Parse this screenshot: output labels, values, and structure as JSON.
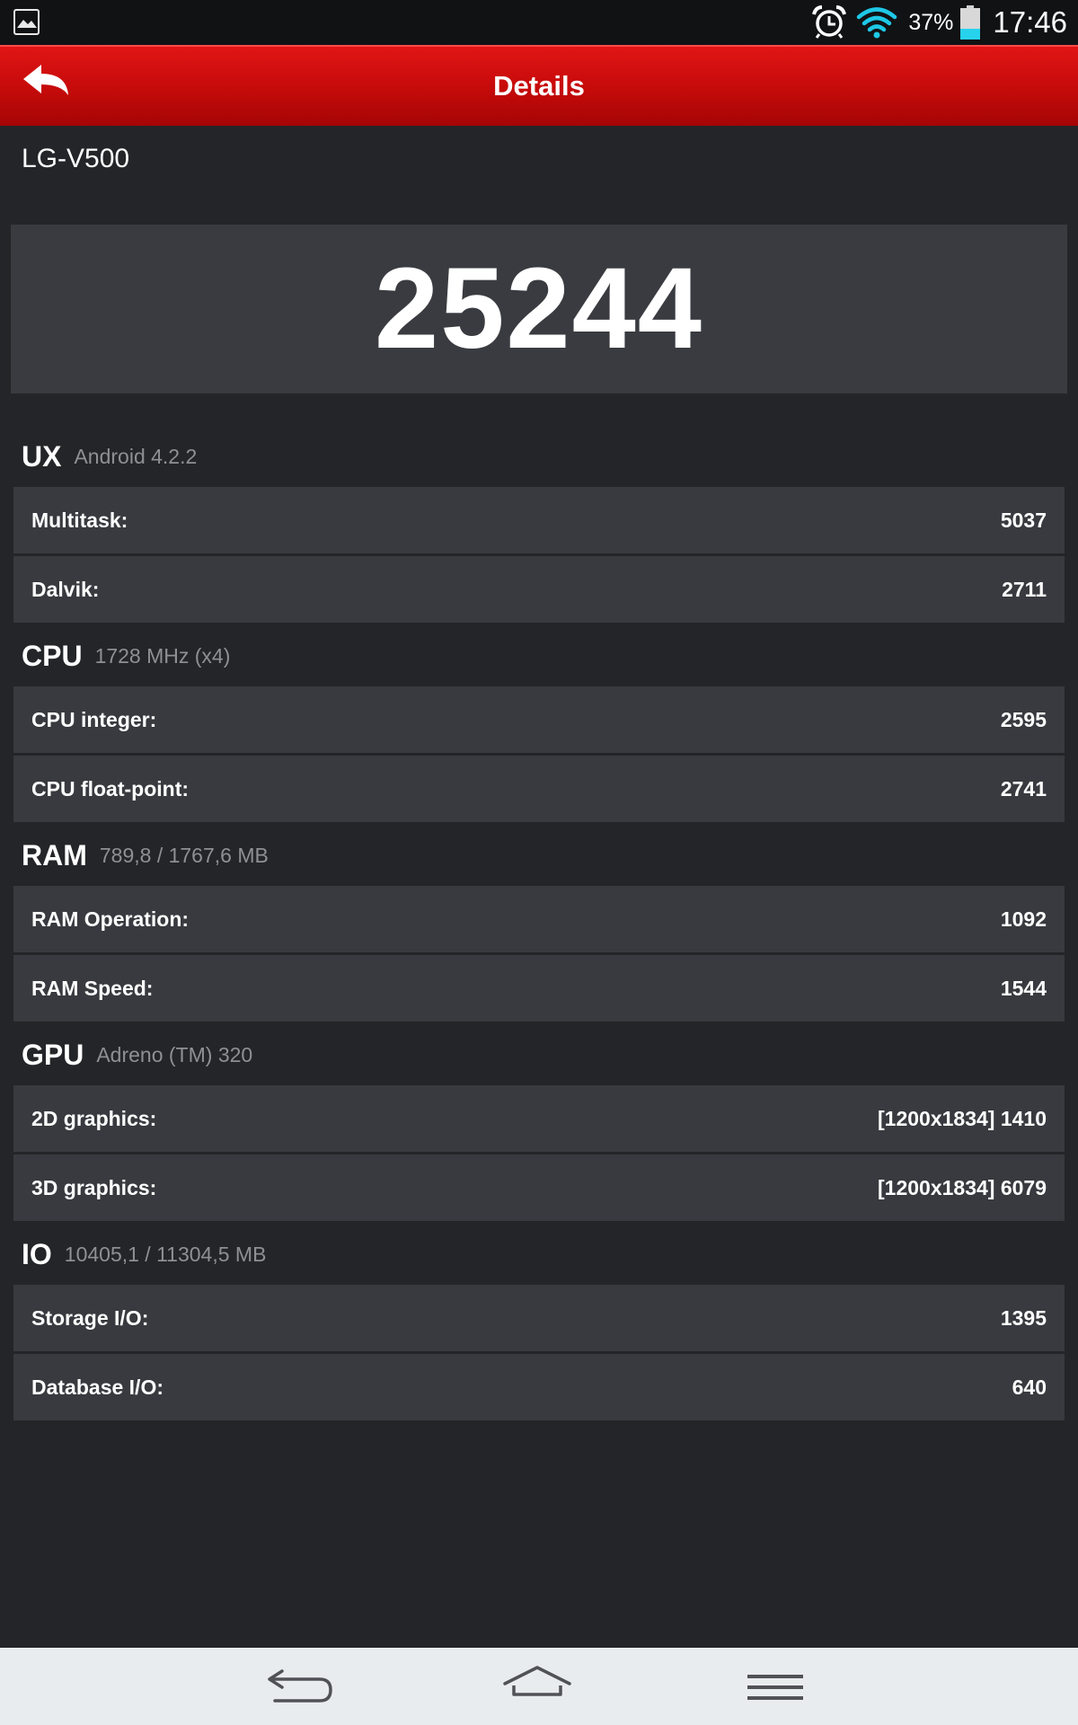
{
  "status_bar": {
    "battery_percent": "37%",
    "time": "17:46",
    "battery_level": 0.37,
    "icons": [
      "gallery-icon",
      "alarm-icon",
      "wifi-icon",
      "battery-icon"
    ]
  },
  "title_bar": {
    "title": "Details",
    "back_icon": "back-arrow-icon"
  },
  "device_name": "LG-V500",
  "total_score": "25244",
  "sections": {
    "ux": {
      "title": "UX",
      "subtitle": "Android 4.2.2",
      "rows": [
        {
          "label": "Multitask:",
          "value": "5037"
        },
        {
          "label": "Dalvik:",
          "value": "2711"
        }
      ]
    },
    "cpu": {
      "title": "CPU",
      "subtitle": "1728 MHz (x4)",
      "rows": [
        {
          "label": "CPU integer:",
          "value": "2595"
        },
        {
          "label": "CPU float-point:",
          "value": "2741"
        }
      ]
    },
    "ram": {
      "title": "RAM",
      "subtitle": "789,8 / 1767,6 MB",
      "rows": [
        {
          "label": "RAM Operation:",
          "value": "1092"
        },
        {
          "label": "RAM Speed:",
          "value": "1544"
        }
      ]
    },
    "gpu": {
      "title": "GPU",
      "subtitle": "Adreno (TM) 320",
      "rows": [
        {
          "label": "2D graphics:",
          "value": "[1200x1834] 1410"
        },
        {
          "label": "3D graphics:",
          "value": "[1200x1834] 6079"
        }
      ]
    },
    "io": {
      "title": "IO",
      "subtitle": "10405,1 / 11304,5 MB",
      "rows": [
        {
          "label": "Storage I/O:",
          "value": "1395"
        },
        {
          "label": "Database I/O:",
          "value": "640"
        }
      ]
    }
  },
  "nav_bar": {
    "icons": [
      "nav-back-icon",
      "nav-home-icon",
      "nav-menu-icon"
    ]
  },
  "colors": {
    "background": "#242528",
    "card": "#393a3f",
    "title_bar_red": "#c50a0a",
    "wifi_cyan": "#1ec8e6",
    "battery_cyan": "#27d2ec",
    "subtitle_gray": "#8e9095"
  }
}
